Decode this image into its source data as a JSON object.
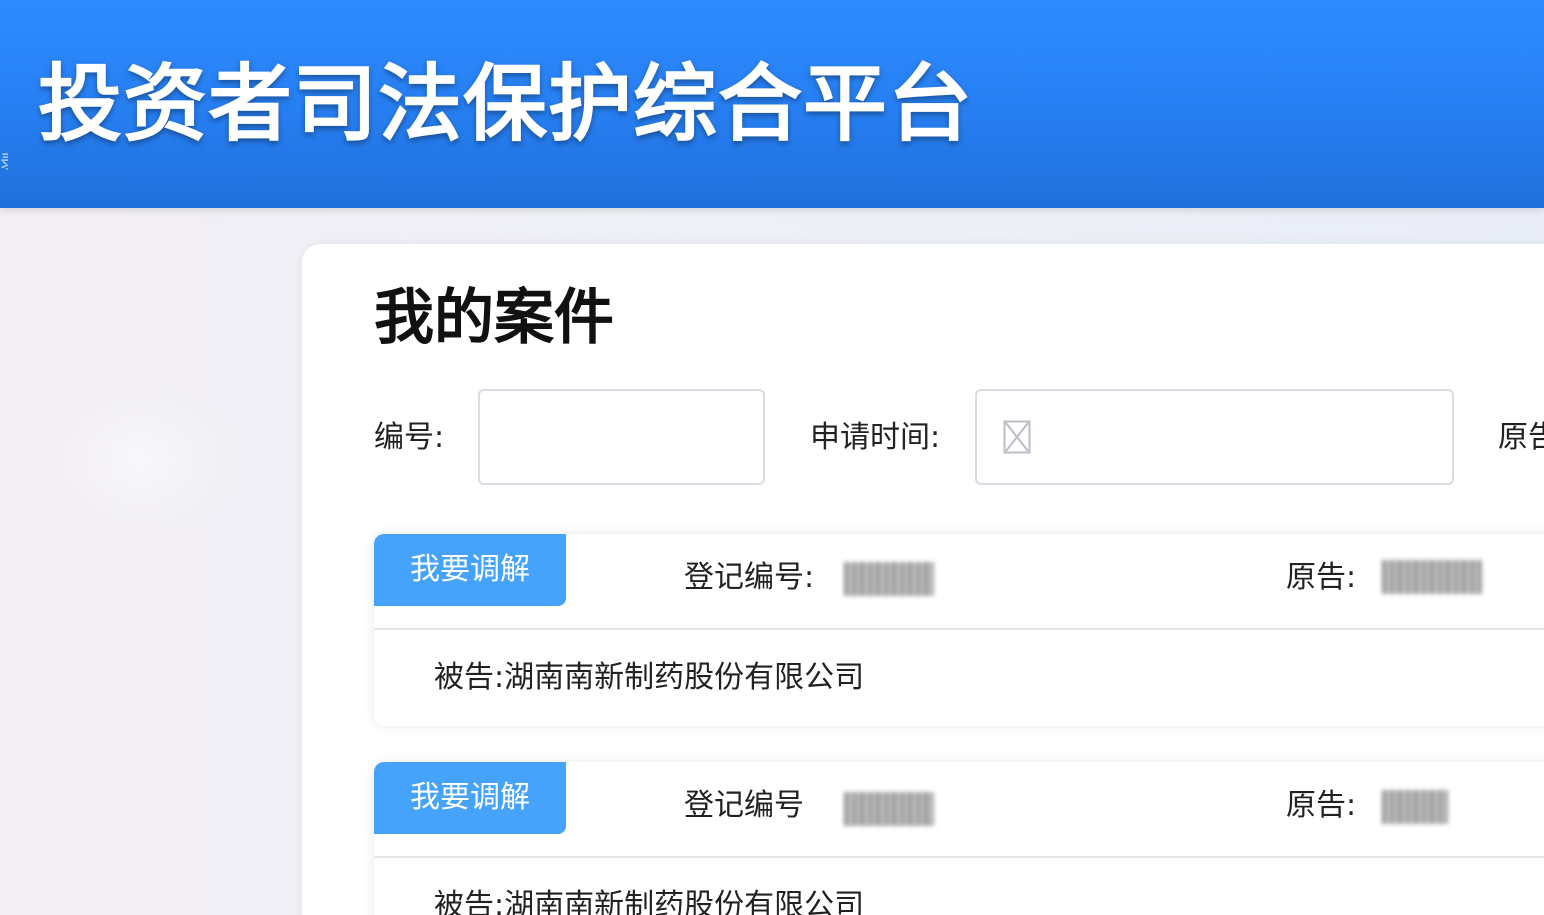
{
  "header": {
    "title": "投资者司法保护综合平台",
    "edge_fragment": "录"
  },
  "page": {
    "title": "我的案件"
  },
  "filters": {
    "number_label": "编号:",
    "number_value": "",
    "date_label": "申请时间:",
    "date_icon": "calendar-placeholder-icon",
    "plaintiff_label_partial": "原告"
  },
  "cases": [
    {
      "action_label": "我要调解",
      "reg_no_label": "登记编号:",
      "reg_no_value": "",
      "plaintiff_label": "原告:",
      "plaintiff_value": "",
      "defendant_label": "被告:",
      "defendant_value": "湖南南新制药股份有限公司"
    },
    {
      "action_label": "我要调解",
      "reg_no_label": "登记编号",
      "reg_no_value": "",
      "plaintiff_label": "原告:",
      "plaintiff_value": "",
      "defendant_label": "被告:",
      "defendant_value": "湖南南新制药股份有限公司"
    }
  ],
  "colors": {
    "header": "#2780f3",
    "button": "#45a3fb"
  }
}
